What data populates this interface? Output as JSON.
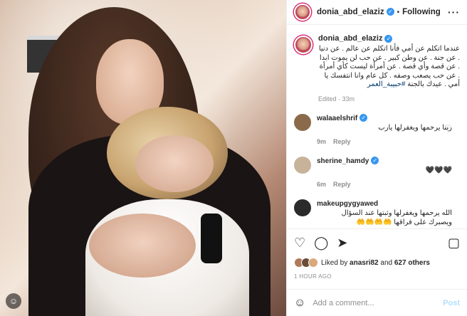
{
  "header": {
    "username": "donia_abd_elaziz",
    "follow_label": "Following",
    "dot": "•"
  },
  "caption": {
    "username": "donia_abd_elaziz",
    "text": "عندما اتكلم عن أمي فأنا اتكلم عن عالم . عن دنيا . عن جنة . عن وطن كبير . عن حب لن يموت ابدا . عن قصة وأي قصة . عن أمرأة ليست كأي أمرأة . عن حب يصعب وصفه . كل عام وانا انتفسك يا أمي . عيدك بالجنة",
    "hashtag": "#حبيبة_العمر",
    "edited": "Edited · 33m"
  },
  "comments": [
    {
      "username": "walaaelshrif",
      "verified": true,
      "text": "ربنا يرحمها ويغفرلها يارب",
      "time": "9m",
      "reply_label": "Reply",
      "avatar_color": "#8a6a4a"
    },
    {
      "username": "sherine_hamdy",
      "verified": true,
      "text": "🖤🖤🖤",
      "time": "6m",
      "reply_label": "Reply",
      "avatar_color": "#c7b39a"
    },
    {
      "username": "makeupgygyawed",
      "verified": false,
      "text": "الله يرحمها ويغفرلها وثبتها عند السؤال ويصبرك على فراقها 🤲🤲🤲🤲",
      "time": "",
      "reply_label": "",
      "avatar_color": "#2b2b2b"
    }
  ],
  "actions": {
    "like_icon": "heart-icon",
    "comment_icon": "comment-icon",
    "share_icon": "share-icon",
    "save_icon": "bookmark-icon"
  },
  "likes": {
    "prefix": "Liked by",
    "user": "anasri82",
    "middle": "and",
    "count": "627 others"
  },
  "time_ago": "1 HOUR AGO",
  "add_comment": {
    "placeholder": "Add a comment...",
    "post_label": "Post"
  }
}
